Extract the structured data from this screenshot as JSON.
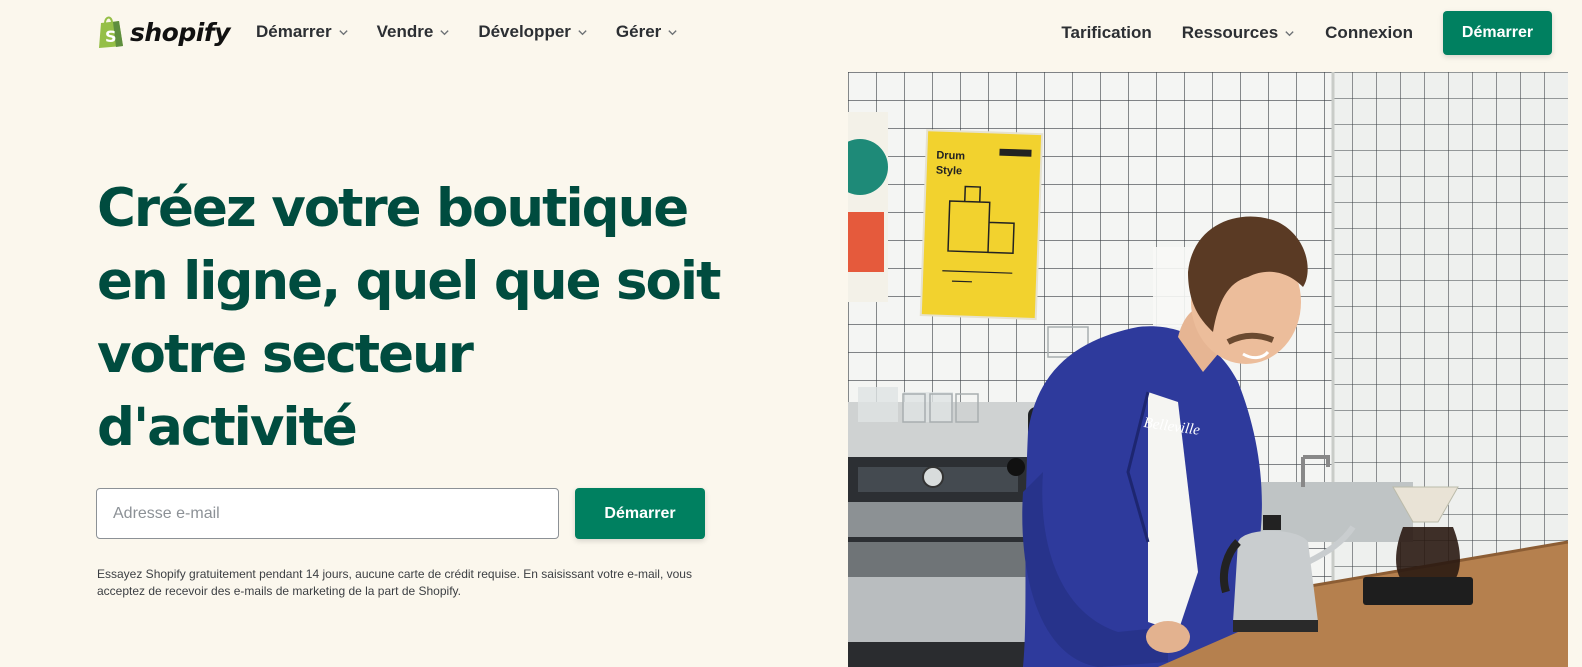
{
  "brand": {
    "name": "shopify",
    "logo_icon": "shopify-bag-icon",
    "logo_color": "#95bf47"
  },
  "nav": {
    "left_items": [
      {
        "label": "Démarrer",
        "icon": "chevron-down-icon"
      },
      {
        "label": "Vendre",
        "icon": "chevron-down-icon"
      },
      {
        "label": "Développer",
        "icon": "chevron-down-icon"
      },
      {
        "label": "Gérer",
        "icon": "chevron-down-icon"
      }
    ],
    "right_items": [
      {
        "label": "Tarification"
      },
      {
        "label": "Ressources",
        "icon": "chevron-down-icon"
      },
      {
        "label": "Connexion"
      }
    ],
    "cta_label": "Démarrer"
  },
  "hero": {
    "headline": "Créez votre boutique en ligne, quel que soit votre secteur d'activité",
    "email_placeholder": "Adresse e-mail",
    "email_value": "",
    "cta_label": "Démarrer",
    "disclaimer": "Essayez Shopify gratuitement pendant 14 jours, aucune carte de crédit requise. En saisissant votre e-mail, vous acceptez de recevoir des e-mails de marketing de la part de Shopify.",
    "image": {
      "poster_title_line1": "Drum",
      "poster_title_line2": "Style",
      "apron_text": "Belleville"
    }
  },
  "colors": {
    "background": "#fbf7ed",
    "headline": "#004c3f",
    "accent": "#008060",
    "apron_blue": "#2e3a9c",
    "poster_yellow": "#f2d22e"
  }
}
